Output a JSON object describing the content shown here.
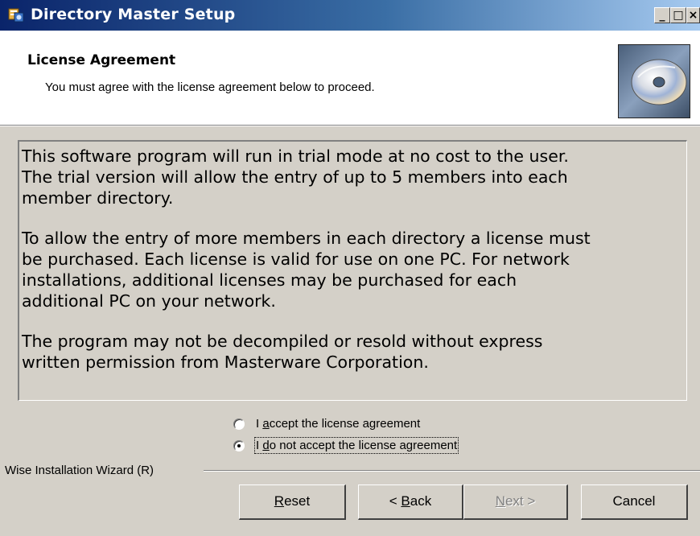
{
  "window": {
    "title": "Directory Master Setup",
    "controls": {
      "minimize": "_",
      "maximize": "□",
      "close": "×"
    }
  },
  "header": {
    "title": "License Agreement",
    "subtitle": "You must agree with the license agreement below to proceed.",
    "image_icon": "cd-disc-icon"
  },
  "license": {
    "paragraphs": [
      "This software program will run in trial mode at no cost to the user.\nThe trial version will allow the entry of up to 5 members into each\nmember directory.",
      "To allow the entry of more members in each directory a license must\nbe purchased.  Each license is valid for use on one PC.  For network\ninstallations, additional licenses may be purchased for each\nadditional PC on your network.",
      "The program may not be decompiled or resold without express\nwritten permission from Masterware Corporation."
    ]
  },
  "options": {
    "accept": {
      "pre": "I ",
      "accel": "a",
      "post": "ccept the license agreement",
      "selected": false
    },
    "decline": {
      "pre": "I ",
      "accel": "d",
      "post": "o not accept the license agreement",
      "selected": true
    }
  },
  "footer": {
    "wizard_label": "Wise Installation Wizard (R)",
    "buttons": {
      "reset": {
        "pre": "",
        "accel": "R",
        "post": "eset",
        "enabled": true
      },
      "back": {
        "pre": "< ",
        "accel": "B",
        "post": "ack",
        "enabled": true
      },
      "next": {
        "pre": "",
        "accel": "N",
        "post": "ext >",
        "enabled": false
      },
      "cancel": {
        "pre": "Cancel",
        "enabled": true
      }
    }
  },
  "colors": {
    "titlebar_start": "#0a246a",
    "titlebar_end": "#a6caf0",
    "face": "#d4d0c8"
  }
}
